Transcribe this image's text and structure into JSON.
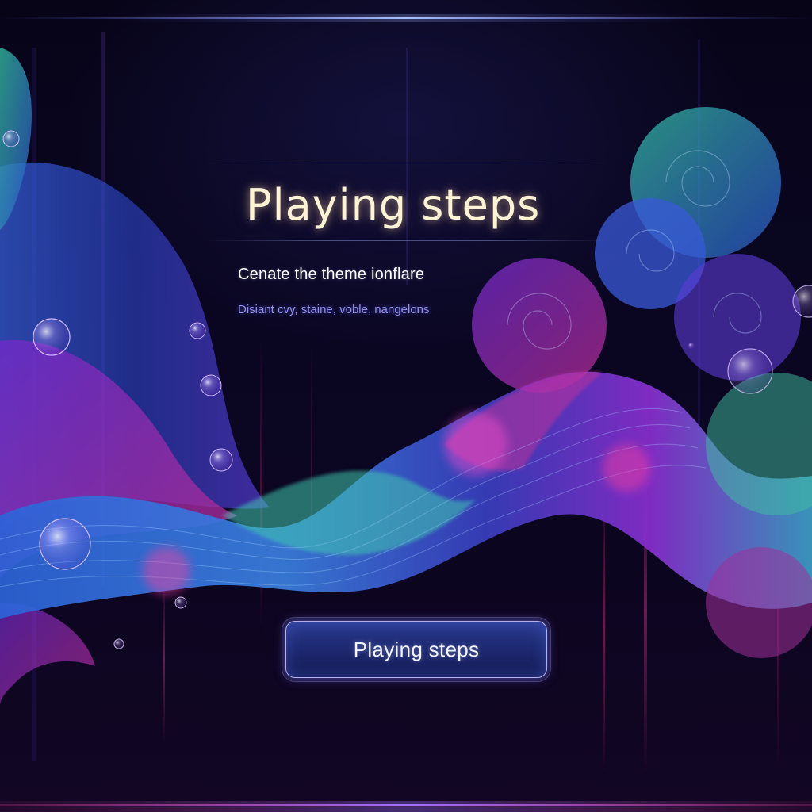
{
  "hero": {
    "title": "Playing steps",
    "subtitle": "Cenate the theme  ionflare",
    "tagline": "Disiant cvy, staine, voble, nangelons"
  },
  "cta": {
    "label": "Playing steps"
  },
  "colors": {
    "background": "#07041a",
    "title_glow": "#fff3d6",
    "tagline": "#8f8ff0",
    "button_fill": "#1e2a73",
    "button_border": "#d2c8ff",
    "wave_blue": "#2f5bd8",
    "wave_purple": "#8a2be2",
    "wave_magenta": "#d0309c",
    "wave_teal": "#3fbfa0"
  }
}
